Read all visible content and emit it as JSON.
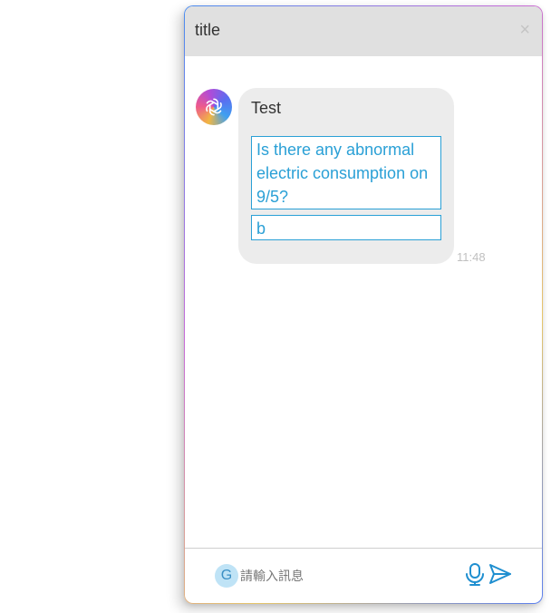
{
  "window": {
    "title": "title",
    "close_glyph": "×"
  },
  "messages": [
    {
      "sender_icon": "openai-logo-icon",
      "text": "Test",
      "options": [
        "Is there any abnormal electric consumption on 9/5?",
        "b"
      ],
      "time": "11:48"
    }
  ],
  "composer": {
    "badge": "G",
    "placeholder": "請輸入訊息",
    "mic_icon": "microphone-icon",
    "send_icon": "send-icon"
  },
  "colors": {
    "header_bg": "#e0e0e0",
    "bubble_bg": "#ececec",
    "accent": "#2aa0d6",
    "timestamp": "#c0c0c0"
  }
}
